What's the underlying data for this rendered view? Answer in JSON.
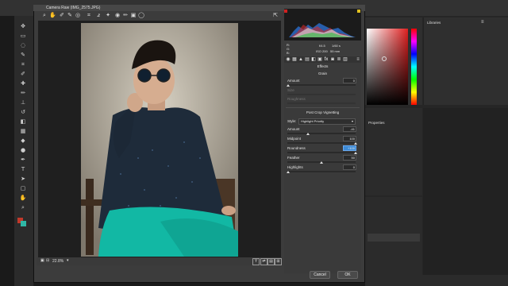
{
  "dialog": {
    "title": "Camera Raw (IMG_2575.JPG)",
    "zoom": "22.8%",
    "cancel_label": "Cancel",
    "ok_label": "OK"
  },
  "exif": {
    "aperture": "f/4.5",
    "iso": "ISO 200",
    "shutter": "1/60 s",
    "focal": "55 mm"
  },
  "effects": {
    "header": "Effects",
    "grain": {
      "title": "Grain",
      "amount_label": "Amount",
      "amount_value": "0",
      "size_label": "Size",
      "roughness_label": "Roughness"
    },
    "vignette": {
      "title": "Post Crop Vignetting",
      "style_label": "Style:",
      "style_value": "Highlight Priority",
      "amount_label": "Amount",
      "amount_value": "-41",
      "midpoint_label": "Midpoint",
      "midpoint_value": "100",
      "roundness_label": "Roundness",
      "roundness_value": "+100",
      "feather_label": "Feather",
      "feather_value": "50",
      "highlights_label": "Highlights",
      "highlights_value": "0"
    }
  },
  "photoshop": {
    "libraries_label": "Libraries",
    "properties_label": "Properties"
  }
}
